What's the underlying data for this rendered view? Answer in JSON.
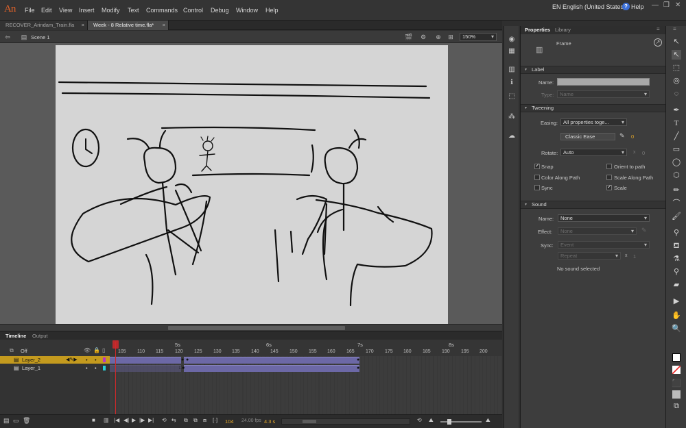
{
  "app": {
    "logo": "An",
    "menu": [
      "File",
      "Edit",
      "View",
      "Insert",
      "Modify",
      "Text",
      "Commands",
      "Control",
      "Debug",
      "Window",
      "Help"
    ],
    "language": "EN English (United States)",
    "help": "Help"
  },
  "tabs": [
    {
      "label": "RECOVER_Arindam_Train.fla",
      "active": false
    },
    {
      "label": "Week - 8 Relative time.fla*",
      "active": true
    }
  ],
  "scene": {
    "label": "Scene 1",
    "zoom": "150%"
  },
  "timeline": {
    "tabs": [
      "Timeline",
      "Output"
    ],
    "seconds": [
      "5s",
      "6s",
      "7s",
      "8s"
    ],
    "frame_numbers": [
      "105",
      "110",
      "115",
      "120",
      "125",
      "130",
      "135",
      "140",
      "145",
      "150",
      "155",
      "160",
      "165",
      "170",
      "175",
      "180",
      "185",
      "190",
      "195",
      "200"
    ],
    "onion_label": "Off",
    "layers": [
      {
        "name": "Layer_2",
        "selected": true,
        "color": "#b533c9"
      },
      {
        "name": "Layer_1",
        "selected": false,
        "color": "#27d0d8"
      }
    ],
    "current_frame": "104",
    "fps": "24.00 fps",
    "elapsed": "4.3 s"
  },
  "properties": {
    "tabs": [
      "Properties",
      "Library"
    ],
    "type": "Frame",
    "label_section": "Label",
    "name_label": "Name:",
    "type_label": "Type:",
    "type_value": "Name",
    "tweening_section": "Tweening",
    "easing_label": "Easing:",
    "easing_value": "All properties toge...",
    "classic_ease": "Classic Ease",
    "ease_value": "0",
    "rotate_label": "Rotate:",
    "rotate_value": "Auto",
    "rotate_times": "x",
    "rotate_count": "0",
    "checks": [
      {
        "label": "Snap",
        "checked": true
      },
      {
        "label": "Orient to path",
        "checked": false
      },
      {
        "label": "Color Along Path",
        "checked": false
      },
      {
        "label": "Scale Along Path",
        "checked": false
      },
      {
        "label": "Sync",
        "checked": false
      },
      {
        "label": "Scale",
        "checked": true
      }
    ],
    "sound_section": "Sound",
    "sound_name_label": "Name:",
    "sound_name_value": "None",
    "effect_label": "Effect:",
    "effect_value": "None",
    "sync_label": "Sync:",
    "sync_value": "Event",
    "repeat_value": "Repeat",
    "repeat_times": "x",
    "repeat_count": "1",
    "no_sound": "No sound selected"
  }
}
